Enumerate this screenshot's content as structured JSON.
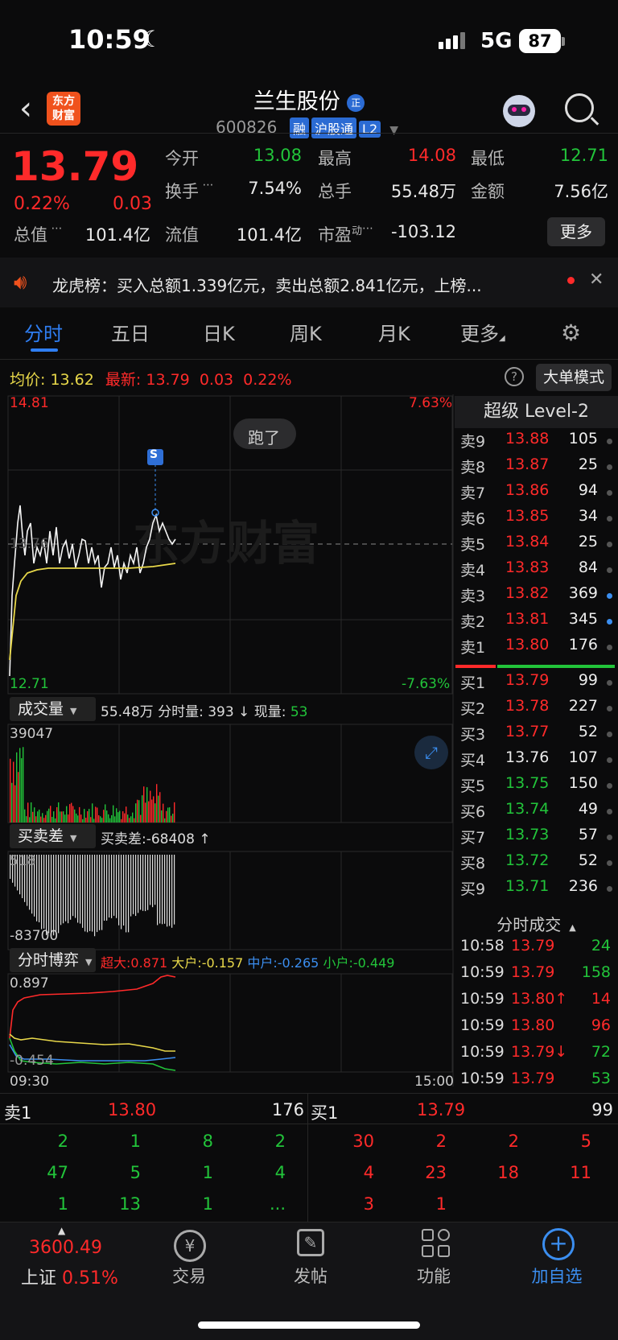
{
  "status": {
    "time": "10:59",
    "network": "5G",
    "battery": "87"
  },
  "header": {
    "back": "‹",
    "logo": "东方财富",
    "name": "兰生股份",
    "name_badge": "正",
    "code": "600826",
    "tags": [
      "融",
      "沪股通",
      "L2"
    ]
  },
  "quote": {
    "price": "13.79",
    "pct": "0.22%",
    "chg": "0.03",
    "fields": [
      {
        "label": "今开",
        "value": "13.08",
        "color": "#22c43a"
      },
      {
        "label": "最高",
        "value": "14.08",
        "color": "#ff2a2a"
      },
      {
        "label": "最低",
        "value": "12.71",
        "color": "#22c43a"
      },
      {
        "label": "换手",
        "value": "7.54%",
        "color": "#eaeaea"
      },
      {
        "label": "总手",
        "value": "55.48万",
        "color": "#eaeaea"
      },
      {
        "label": "金额",
        "value": "7.56亿",
        "color": "#eaeaea"
      },
      {
        "label": "总值",
        "value": "101.4亿",
        "color": "#eaeaea"
      },
      {
        "label": "流值",
        "value": "101.4亿",
        "color": "#eaeaea"
      },
      {
        "label": "市盈",
        "label_sup": "动",
        "value": "-103.12",
        "color": "#eaeaea"
      }
    ],
    "more": "更多"
  },
  "banner": {
    "text": "龙虎榜：买入总额1.339亿元，卖出总额2.841亿元，上榜..."
  },
  "tabs": [
    "分时",
    "五日",
    "日K",
    "周K",
    "月K",
    "更多"
  ],
  "avg": {
    "avg_label": "均价:",
    "avg": "13.62",
    "latest_label": "最新:",
    "latest": "13.79",
    "chg": "0.03",
    "pct": "0.22%",
    "big_order": "大单模式"
  },
  "chart": {
    "top_price": "14.81",
    "top_pct": "7.63%",
    "bottom_price": "12.71",
    "bottom_pct": "-7.63%",
    "mid_label": "13.76",
    "tooltip": "跑了",
    "signal": "S",
    "watermark": "东方财富"
  },
  "volume": {
    "title": "成交量",
    "summary": "55.48万 分时量: 393 ↓ 现量: ",
    "now": "53",
    "max": "39047"
  },
  "diff": {
    "title": "买卖差",
    "summary": "买卖差:-68408 ↑",
    "top": "518",
    "bottom": "-83700"
  },
  "game": {
    "title": "分时博弈",
    "super": "超大:0.871",
    "big": "大户:-0.157",
    "mid": "中户:-0.265",
    "small": "小户:-0.449",
    "top": "0.897",
    "bottom": "-0.454",
    "start": "09:30",
    "end": "15:00"
  },
  "orderbook": {
    "title": "超级 Level-2",
    "sells": [
      {
        "k": "卖9",
        "p": "13.88",
        "v": "105",
        "c": "#ff2a2a",
        "dot": "#555"
      },
      {
        "k": "卖8",
        "p": "13.87",
        "v": "25",
        "c": "#ff2a2a",
        "dot": "#555"
      },
      {
        "k": "卖7",
        "p": "13.86",
        "v": "94",
        "c": "#ff2a2a",
        "dot": "#555"
      },
      {
        "k": "卖6",
        "p": "13.85",
        "v": "34",
        "c": "#ff2a2a",
        "dot": "#555"
      },
      {
        "k": "卖5",
        "p": "13.84",
        "v": "25",
        "c": "#ff2a2a",
        "dot": "#555"
      },
      {
        "k": "卖4",
        "p": "13.83",
        "v": "84",
        "c": "#ff2a2a",
        "dot": "#555"
      },
      {
        "k": "卖3",
        "p": "13.82",
        "v": "369",
        "c": "#ff2a2a",
        "dot": "#3b8ef0"
      },
      {
        "k": "卖2",
        "p": "13.81",
        "v": "345",
        "c": "#ff2a2a",
        "dot": "#3b8ef0"
      },
      {
        "k": "卖1",
        "p": "13.80",
        "v": "176",
        "c": "#ff2a2a",
        "dot": "#555"
      }
    ],
    "buys": [
      {
        "k": "买1",
        "p": "13.79",
        "v": "99",
        "c": "#ff2a2a",
        "dot": "#555"
      },
      {
        "k": "买2",
        "p": "13.78",
        "v": "227",
        "c": "#ff2a2a",
        "dot": "#555"
      },
      {
        "k": "买3",
        "p": "13.77",
        "v": "52",
        "c": "#ff2a2a",
        "dot": "#555"
      },
      {
        "k": "买4",
        "p": "13.76",
        "v": "107",
        "c": "#eaeaea",
        "dot": "#555"
      },
      {
        "k": "买5",
        "p": "13.75",
        "v": "150",
        "c": "#22c43a",
        "dot": "#555"
      },
      {
        "k": "买6",
        "p": "13.74",
        "v": "49",
        "c": "#22c43a",
        "dot": "#555"
      },
      {
        "k": "买7",
        "p": "13.73",
        "v": "57",
        "c": "#22c43a",
        "dot": "#555"
      },
      {
        "k": "买8",
        "p": "13.72",
        "v": "52",
        "c": "#22c43a",
        "dot": "#555"
      },
      {
        "k": "买9",
        "p": "13.71",
        "v": "236",
        "c": "#22c43a",
        "dot": "#555"
      }
    ],
    "trades_title": "分时成交",
    "trades": [
      {
        "t": "10:58",
        "p": "13.79",
        "v": "24",
        "pc": "#ff2a2a",
        "vc": "#22c43a"
      },
      {
        "t": "10:59",
        "p": "13.79",
        "v": "158",
        "pc": "#ff2a2a",
        "vc": "#22c43a"
      },
      {
        "t": "10:59",
        "p": "13.80↑",
        "v": "14",
        "pc": "#ff2a2a",
        "vc": "#ff2a2a"
      },
      {
        "t": "10:59",
        "p": "13.80",
        "v": "96",
        "pc": "#ff2a2a",
        "vc": "#ff2a2a"
      },
      {
        "t": "10:59",
        "p": "13.79↓",
        "v": "72",
        "pc": "#ff2a2a",
        "vc": "#22c43a"
      },
      {
        "t": "10:59",
        "p": "13.79",
        "v": "53",
        "pc": "#ff2a2a",
        "vc": "#22c43a"
      }
    ]
  },
  "bottom": {
    "sell_label": "卖1",
    "sell_price": "13.80",
    "sell_vol": "176",
    "buy_label": "买1",
    "buy_price": "13.79",
    "buy_vol": "99",
    "left_rows": [
      [
        "2",
        "1",
        "8",
        "2"
      ],
      [
        "47",
        "5",
        "1",
        "4"
      ],
      [
        "1",
        "13",
        "1",
        "..."
      ]
    ],
    "right_rows": [
      [
        "30",
        "2",
        "2",
        "5"
      ],
      [
        "4",
        "23",
        "18",
        "11"
      ],
      [
        "3",
        "1",
        "",
        ""
      ]
    ]
  },
  "nav": {
    "index_value": "3600.49",
    "index_name": "上证",
    "index_pct": "0.51%",
    "items": [
      "交易",
      "发帖",
      "功能",
      "加自选"
    ]
  }
}
